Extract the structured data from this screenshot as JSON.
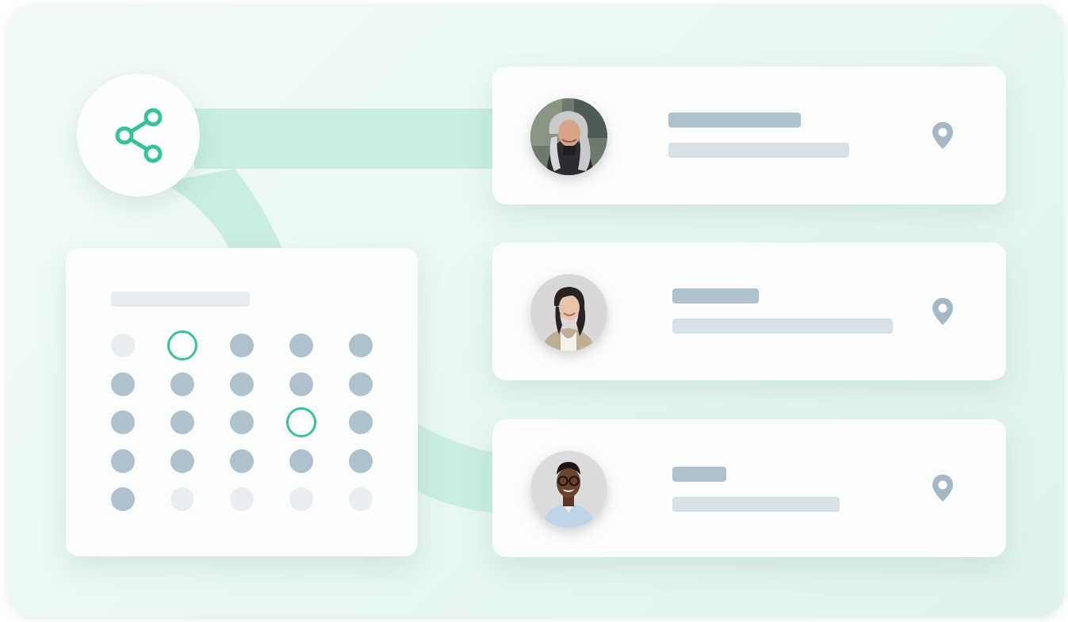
{
  "colors": {
    "accent": "#35c299",
    "connector": "#c5ece0",
    "placeholder_dark": "#b0c1ce",
    "placeholder_light": "#d8e1e7",
    "day_filled": "#b0c1ce",
    "day_empty": "#e9edf0"
  },
  "share": {
    "icon": "share-icon"
  },
  "people": [
    {
      "avatar": "avatar-woman-gray-hair",
      "icon": "location-pin-icon"
    },
    {
      "avatar": "avatar-woman-dark-hair",
      "icon": "location-pin-icon"
    },
    {
      "avatar": "avatar-man-glasses",
      "icon": "location-pin-icon"
    }
  ],
  "calendar": {
    "rows": [
      [
        "empty",
        "selected",
        "filled",
        "filled",
        "filled"
      ],
      [
        "filled",
        "filled",
        "filled",
        "filled",
        "filled"
      ],
      [
        "filled",
        "filled",
        "filled",
        "selected",
        "filled"
      ],
      [
        "filled",
        "filled",
        "filled",
        "filled",
        "filled"
      ],
      [
        "filled",
        "empty",
        "empty",
        "empty",
        "empty"
      ]
    ]
  }
}
